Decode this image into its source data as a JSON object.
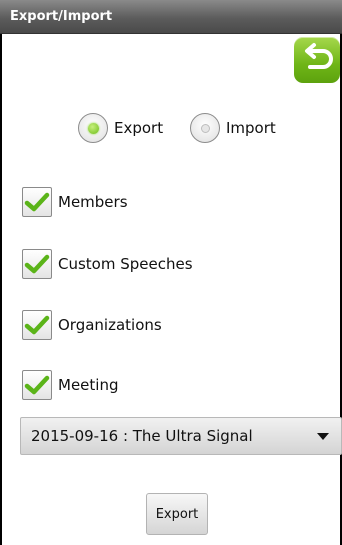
{
  "window": {
    "title": "Export/Import"
  },
  "toolbar": {
    "back_icon": "back-arrow-icon"
  },
  "mode": {
    "export_label": "Export",
    "import_label": "Import",
    "selected": "Export"
  },
  "options": [
    {
      "label": "Members",
      "checked": true
    },
    {
      "label": "Custom Speeches",
      "checked": true
    },
    {
      "label": "Organizations",
      "checked": true
    },
    {
      "label": "Meeting",
      "checked": true
    }
  ],
  "meeting_select": {
    "value": "2015-09-16 : The Ultra Signal"
  },
  "actions": {
    "export_label": "Export"
  },
  "colors": {
    "accent_green": "#6fb517",
    "titlebar": "#5c5c5c"
  }
}
